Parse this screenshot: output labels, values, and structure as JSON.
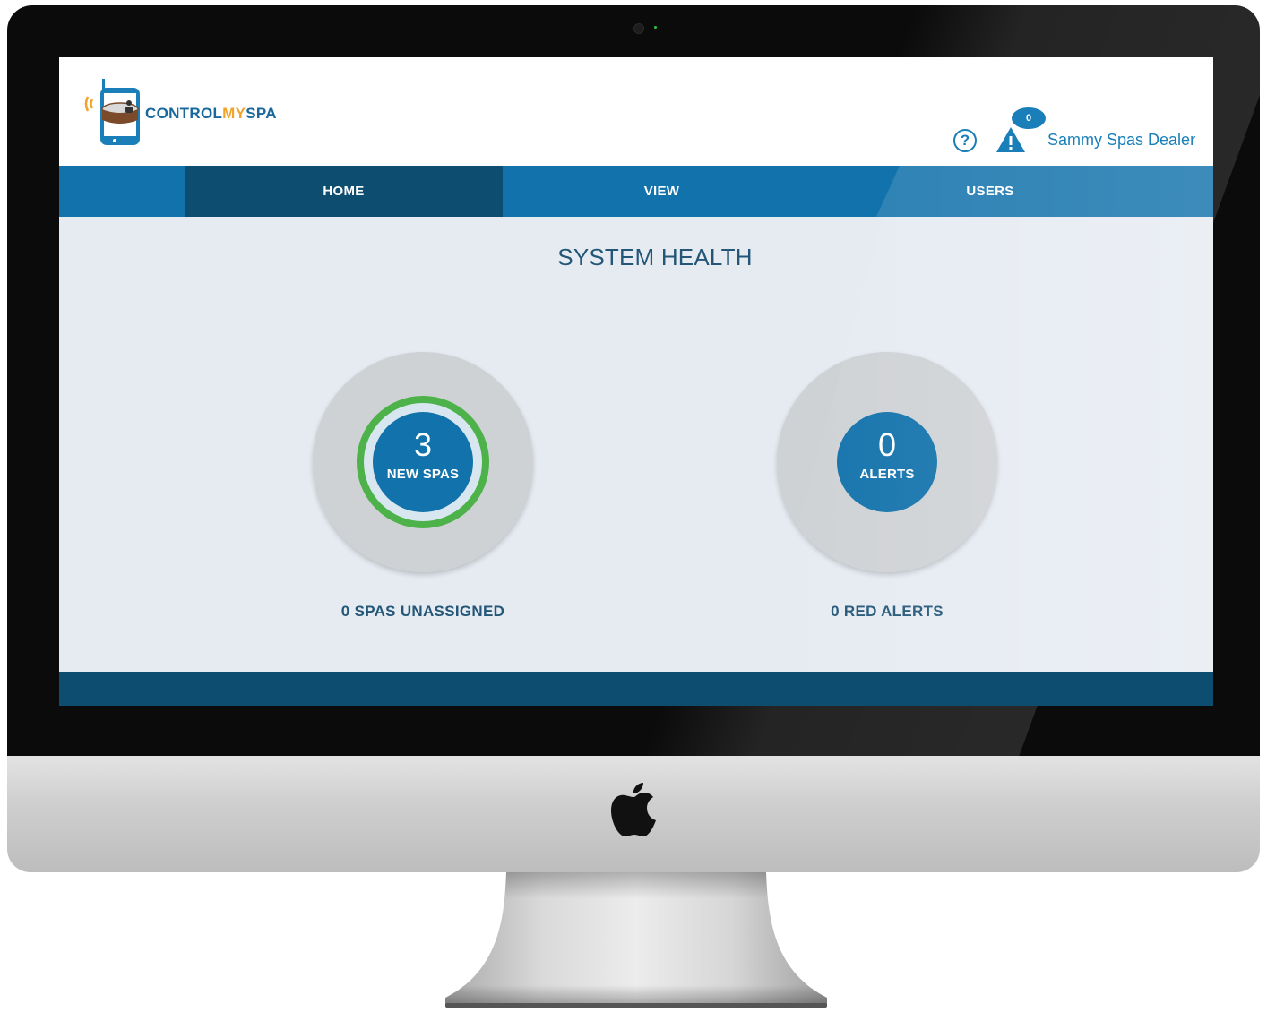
{
  "brand": {
    "name_part1": "CONTROL",
    "name_part2": "MY",
    "name_part3": "SPA",
    "accent_blue": "#1272ab",
    "accent_orange": "#f2a32a",
    "logo_icon": "phone-hot-tub-icon"
  },
  "header": {
    "help_icon_glyph": "?",
    "alert_count": "0",
    "user_name": "Sammy Spas Dealer"
  },
  "nav": {
    "tabs": [
      {
        "label": "HOME",
        "active": true
      },
      {
        "label": "VIEW",
        "active": false
      },
      {
        "label": "USERS",
        "active": false
      }
    ]
  },
  "main": {
    "title": "SYSTEM HEALTH",
    "tiles": [
      {
        "value": "3",
        "label": "NEW SPAS",
        "caption": "0 SPAS UNASSIGNED",
        "ring_color": "#4db24a"
      },
      {
        "value": "0",
        "label": "ALERTS",
        "caption": "0 RED ALERTS"
      }
    ]
  },
  "device": {
    "logo": "apple-logo"
  }
}
